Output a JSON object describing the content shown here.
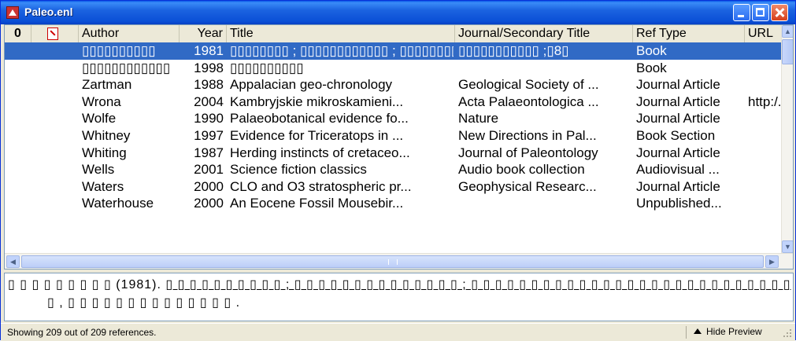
{
  "window": {
    "title": "Paleo.enl"
  },
  "columns": {
    "attach": "0",
    "author": "Author",
    "year": "Year",
    "title": "Title",
    "journal": "Journal/Secondary Title",
    "reftype": "Ref Type",
    "url": "URL"
  },
  "rows": [
    {
      "author": "▯▯▯▯▯▯▯▯▯▯",
      "year": "1981",
      "title": "▯▯▯▯▯▯▯▯ ; ▯▯▯▯▯▯▯▯▯▯▯▯ ; ▯▯▯▯▯▯▯▯▯▯▯▯▯▯▯▯▯▯▯",
      "journal": "▯▯▯▯▯▯▯▯▯▯▯ ;▯8▯",
      "reftype": "Book",
      "url": "",
      "selected": true
    },
    {
      "author": "▯▯▯▯▯▯▯▯▯▯▯▯",
      "year": "1998",
      "title": "▯▯▯▯▯▯▯▯▯▯",
      "journal": "",
      "reftype": "Book",
      "url": ""
    },
    {
      "author": "Zartman",
      "year": "1988",
      "title": "Appalacian geo-chronology",
      "journal": "Geological Society of ...",
      "reftype": "Journal Article",
      "url": ""
    },
    {
      "author": "Wrona",
      "year": "2004",
      "title": "Kambryjskie mikroskamieni...",
      "journal": "Acta Palaeontologica ...",
      "reftype": "Journal Article",
      "url": "http:/."
    },
    {
      "author": "Wolfe",
      "year": "1990",
      "title": "Palaeobotanical evidence fo...",
      "journal": "Nature",
      "reftype": "Journal Article",
      "url": ""
    },
    {
      "author": "Whitney",
      "year": "1997",
      "title": "Evidence for Triceratops in ...",
      "journal": "New Directions in Pal...",
      "reftype": "Book Section",
      "url": ""
    },
    {
      "author": "Whiting",
      "year": "1987",
      "title": "Herding instincts of cretaceo...",
      "journal": "Journal of Paleontology",
      "reftype": "Journal Article",
      "url": ""
    },
    {
      "author": "Wells",
      "year": "2001",
      "title": "Science fiction classics",
      "journal": "Audio book collection",
      "reftype": "Audiovisual ...",
      "url": ""
    },
    {
      "author": "Waters",
      "year": "2000",
      "title": "CLO and O3 stratospheric pr...",
      "journal": "Geophysical Researc...",
      "reftype": "Journal Article",
      "url": ""
    },
    {
      "author": "Waterhouse",
      "year": "2000",
      "title": "An Eocene Fossil Mousebir...",
      "journal": "",
      "reftype": "Unpublished...",
      "url": ""
    }
  ],
  "preview": {
    "line1_a": "▯ ▯ ▯ ▯ ▯ ▯ ▯ ▯ ▯  (1981).",
    "line1_b": "▯ ▯ ▯ ▯ ▯ ▯ ▯ ▯ ▯ ▯  ; ▯ ▯ ▯ ▯ ▯ ▯ ▯ ▯ ▯ ▯ ▯ ▯ ▯ ▯  ; ▯ ▯ ▯ ▯ ▯ ▯ ▯ ▯ ▯ ▯ ▯ ▯ ▯ ▯ ▯ ▯ ▯ ▯ ▯ ▯ ▯ ▯ ▯ ▯ ▯ ▯ ▯",
    "line1_c": ". ▯",
    "line2": "▯ , ▯ ▯ ▯ ▯ ▯ ▯ ▯ ▯ ▯ ▯ ▯ ▯ ▯ ▯ ."
  },
  "status": {
    "text": "Showing 209 out of 209 references.",
    "hide_preview": "Hide Preview"
  }
}
